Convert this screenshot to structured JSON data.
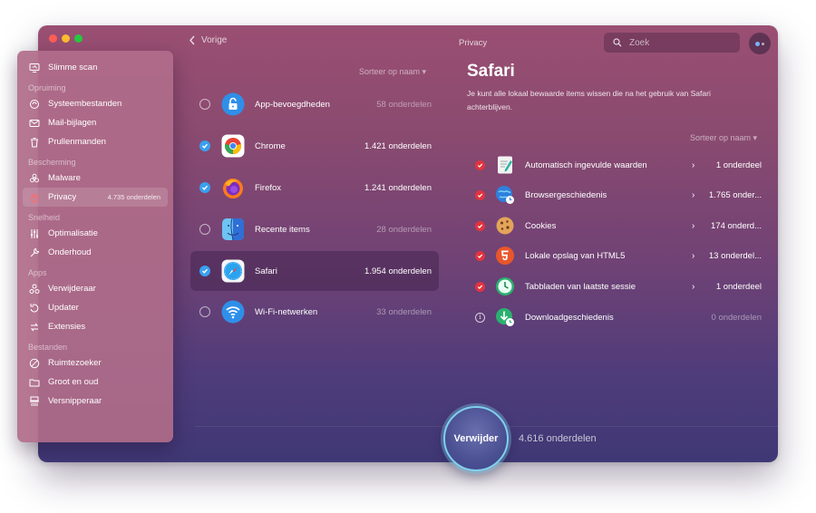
{
  "toolbar": {
    "back_label": "Vorige",
    "title": "Privacy",
    "search_placeholder": "Zoek"
  },
  "sidebar": {
    "top_item": {
      "label": "Slimme scan",
      "icon": "monitor-scan-icon"
    },
    "sections": [
      {
        "title": "Opruiming",
        "items": [
          {
            "label": "Systeembestanden",
            "icon": "recycle-icon"
          },
          {
            "label": "Mail-bijlagen",
            "icon": "envelope-icon"
          },
          {
            "label": "Prullenmanden",
            "icon": "trash-icon"
          }
        ]
      },
      {
        "title": "Bescherming",
        "items": [
          {
            "label": "Malware",
            "icon": "biohazard-icon"
          },
          {
            "label": "Privacy",
            "icon": "hand-icon",
            "count": "4.735 onderdelen",
            "active": true
          }
        ]
      },
      {
        "title": "Snelheid",
        "items": [
          {
            "label": "Optimalisatie",
            "icon": "sliders-icon"
          },
          {
            "label": "Onderhoud",
            "icon": "wrench-icon"
          }
        ]
      },
      {
        "title": "Apps",
        "items": [
          {
            "label": "Verwijderaar",
            "icon": "uninstaller-icon"
          },
          {
            "label": "Updater",
            "icon": "update-arrow-icon"
          },
          {
            "label": "Extensies",
            "icon": "extensions-icon"
          }
        ]
      },
      {
        "title": "Bestanden",
        "items": [
          {
            "label": "Ruimtezoeker",
            "icon": "space-lens-icon"
          },
          {
            "label": "Groot en oud",
            "icon": "folder-icon"
          },
          {
            "label": "Versnipperaar",
            "icon": "shredder-icon"
          }
        ]
      }
    ]
  },
  "apps": {
    "sort_label": "Sorteer op naam ▾",
    "items": [
      {
        "name": "App-bevoegdheden",
        "count": "58 onderdelen",
        "checked": false,
        "icon": "lock-app-icon"
      },
      {
        "name": "Chrome",
        "count": "1.421 onderdelen",
        "checked": true,
        "icon": "chrome-icon"
      },
      {
        "name": "Firefox",
        "count": "1.241 onderdelen",
        "checked": true,
        "icon": "firefox-icon"
      },
      {
        "name": "Recente items",
        "count": "28 onderdelen",
        "checked": false,
        "icon": "finder-icon"
      },
      {
        "name": "Safari",
        "count": "1.954 onderdelen",
        "checked": true,
        "selected": true,
        "icon": "safari-icon"
      },
      {
        "name": "Wi-Fi-netwerken",
        "count": "33 onderdelen",
        "checked": false,
        "icon": "wifi-icon"
      }
    ]
  },
  "detail": {
    "title": "Safari",
    "description": "Je kunt alle lokaal bewaarde items wissen die na het gebruik van Safari achterblijven.",
    "sort_label": "Sorteer op naam ▾",
    "items": [
      {
        "name": "Automatisch ingevulde waarden",
        "count": "1 onderdeel",
        "checked": true,
        "chevron": "›",
        "icon": "autofill-icon"
      },
      {
        "name": "Browsergeschiedenis",
        "count": "1.765 onder...",
        "checked": true,
        "chevron": "›",
        "icon": "globe-clock-icon"
      },
      {
        "name": "Cookies",
        "count": "174 onderd...",
        "checked": true,
        "chevron": "›",
        "icon": "cookie-icon"
      },
      {
        "name": "Lokale opslag van HTML5",
        "count": "13 onderdel...",
        "checked": true,
        "chevron": "›",
        "icon": "html5-icon"
      },
      {
        "name": "Tabbladen van laatste sessie",
        "count": "1 onderdeel",
        "checked": true,
        "chevron": "›",
        "icon": "clock-icon"
      },
      {
        "name": "Downloadgeschiedenis",
        "count": "0 onderdelen",
        "checked": false,
        "info": "i",
        "icon": "download-icon"
      }
    ]
  },
  "footer": {
    "remove_label": "Verwijder",
    "total": "4.616 onderdelen"
  },
  "colors": {
    "accent_blue": "#3aa0f0",
    "check_red": "#e0343f",
    "button_ring": "#7fd0ee"
  }
}
